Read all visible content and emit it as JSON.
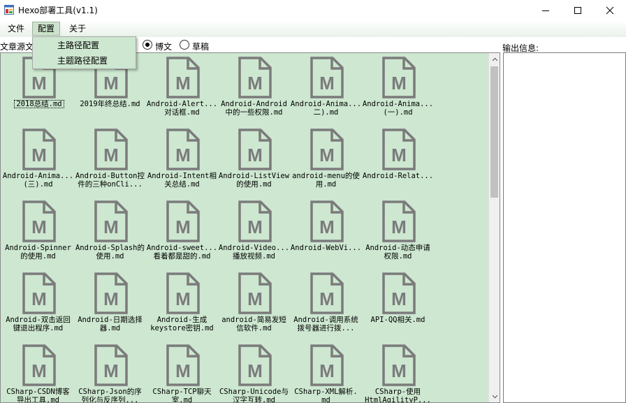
{
  "window": {
    "title": "Hexo部署工具(v1.1)"
  },
  "menu": {
    "items": [
      "文件",
      "配置",
      "关于"
    ],
    "dropdown": [
      "主路径配置",
      "主题路径配置"
    ]
  },
  "toolbar": {
    "source_label": "文章源文",
    "radio_post": "博文",
    "radio_draft": "草稿",
    "selected": "博文"
  },
  "output": {
    "label": "输出信息:"
  },
  "icons": {
    "file": "markdown-file-icon",
    "icon_letter": "M"
  },
  "colors": {
    "panel_bg": "#cde7d0",
    "icon": "#7b7b7b",
    "menu_hover": "#cde3cd"
  },
  "files": [
    "2018总结.md",
    "2019年终总结.md",
    "Android-Alert...\n对话框.md",
    "Android-Android\n中的一些权限.md",
    "Android-Anima...\n二).md",
    "Android-Anima...\n(一).md",
    "Android-Anima...\n(三).md",
    "Android-Button控\n件的三种onCli...",
    "Android-Intent相\n关总结.md",
    "Android-ListView\n的使用.md",
    "android-menu的使\n用.md",
    "Android-Relat...",
    "Android-Spinner\n的使用.md",
    "Android-Splash的\n使用.md",
    "Android-sweet...\n看着都是甜的.md",
    "Android-Video...\n播放视频.md",
    "Android-WebVi...",
    "Android-动态申请\n权限.md",
    "Android-双击返回\n键退出程序.md",
    "Android-日期选择\n器.md",
    "Android-生成\nkeystore密钥.md",
    "android-简易发短\n信软件.md",
    "Android-调用系统\n拨号器进行拨...",
    "API-QQ相关.md",
    "CSharp-CSDN博客\n导出工具.md",
    "CSharp-Json的序\n列化与反序列...",
    "CSharp-TCP聊天\n室.md",
    "CSharp-Unicode与\n汉字互转.md",
    "CSharp-XML解析.\nmd",
    "CSharp-使用\nHtmlAgilityP..."
  ]
}
